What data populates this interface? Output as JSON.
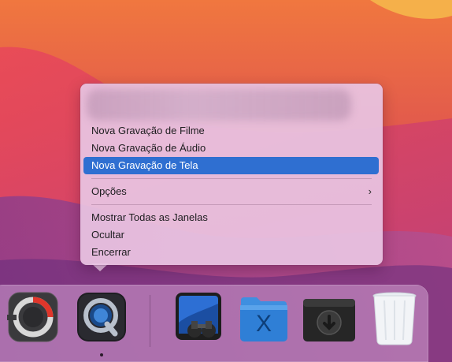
{
  "menu": {
    "items": [
      {
        "label": "Nova Gravação de Filme"
      },
      {
        "label": "Nova Gravação de Áudio"
      },
      {
        "label": "Nova Gravação de Tela"
      },
      {
        "label": "Opções"
      },
      {
        "label": "Mostrar Todas as Janelas"
      },
      {
        "label": "Ocultar"
      },
      {
        "label": "Encerrar"
      }
    ],
    "selected_item": "Nova Gravação de Tela",
    "submenu_arrow": "›",
    "colors": {
      "highlight": "#2f6fd1"
    }
  },
  "dock": {
    "apps": [
      {
        "icon": "photobooth-like-app-icon"
      },
      {
        "icon": "quicktime-player-icon",
        "running": true
      },
      {
        "icon": "preview-binoculars-icon"
      },
      {
        "icon": "xcode-folder-icon"
      },
      {
        "icon": "disk-installer-icon"
      },
      {
        "icon": "trash-icon"
      }
    ]
  }
}
